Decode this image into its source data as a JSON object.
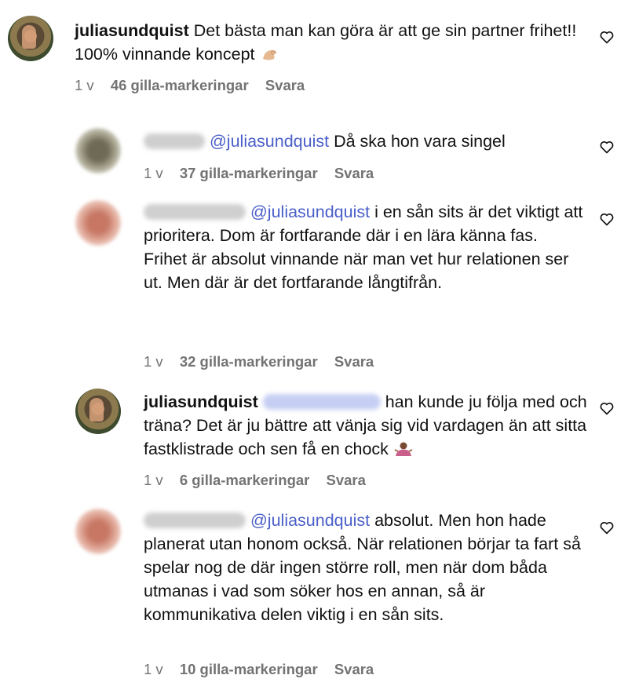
{
  "comments": [
    {
      "username": "juliasundquist",
      "mention": "",
      "text": "Det bästa man kan göra är att ge sin partner frihet!! 100% vinnande koncept",
      "emoji": "ok-hand-emoji",
      "time": "1 v",
      "likes": "46 gilla-markeringar",
      "reply": "Svara"
    },
    {
      "username": "",
      "mention": "@juliasundquist",
      "text": "Då ska hon vara singel",
      "time": "1 v",
      "likes": "37 gilla-markeringar",
      "reply": "Svara"
    },
    {
      "username": "",
      "mention": "@juliasundquist",
      "text_line1": "i en sån sits är det",
      "text_rest": "viktigt att prioritera. Dom är fortfarande där i en lära känna fas.",
      "text_para2": "Frihet är absolut vinnande när man vet hur relationen ser ut. Men där är det fortfarande långtifrån.",
      "time": "1 v",
      "likes": "32 gilla-markeringar",
      "reply": "Svara"
    },
    {
      "username": "juliasundquist",
      "mention": "",
      "text_line1": "han kunde ju följa med",
      "text_rest": "och träna? Det är ju bättre att vänja sig vid vardagen än att sitta fastklistrade och sen få en chock",
      "emoji": "shrug-emoji",
      "time": "1 v",
      "likes": "6 gilla-markeringar",
      "reply": "Svara"
    },
    {
      "username": "",
      "mention": "@juliasundquist",
      "text_line1": "absolut. Men hon",
      "text_rest": "hade planerat utan honom också. När relationen börjar ta fart så spelar nog de där ingen större roll, men när dom båda utmanas i vad som söker hos en annan, så är kommunikativa delen viktig i en sån sits.",
      "time": "1 v",
      "likes": "10 gilla-markeringar",
      "reply": "Svara"
    }
  ],
  "icons": {
    "like": "heart-outline-icon"
  },
  "colors": {
    "mention": "#4a5fc9",
    "meta": "#737373"
  }
}
